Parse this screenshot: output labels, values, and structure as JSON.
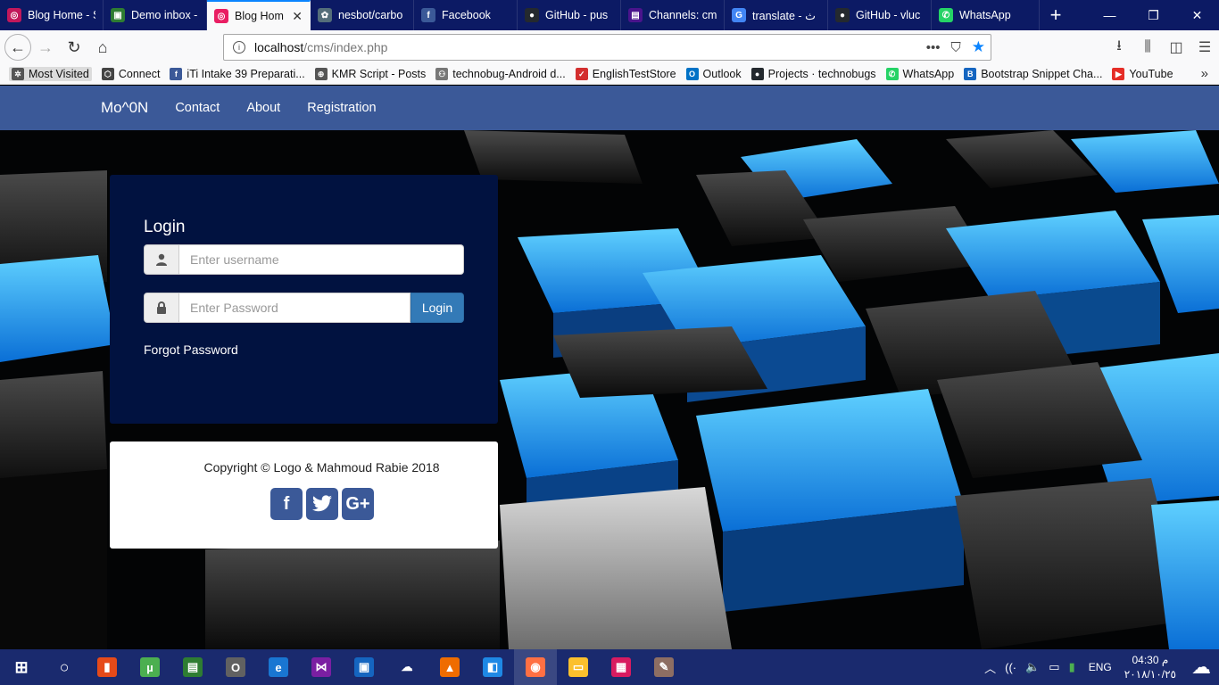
{
  "browser": {
    "tabs": [
      {
        "title": "Blog Home - S",
        "favicon_color": "#c2185b",
        "glyph": "◎"
      },
      {
        "title": "Demo inbox -",
        "favicon_color": "#2e7d32",
        "glyph": "▣"
      },
      {
        "title": "Blog Hom",
        "favicon_color": "#e91e63",
        "glyph": "◎",
        "active": true,
        "close": "✕"
      },
      {
        "title": "nesbot/carbo",
        "favicon_color": "#546e7a",
        "glyph": "✿"
      },
      {
        "title": "Facebook",
        "favicon_color": "#3b5998",
        "glyph": "f"
      },
      {
        "title": "GitHub - pus",
        "favicon_color": "#24292e",
        "glyph": "●"
      },
      {
        "title": "Channels: cm",
        "favicon_color": "#4a148c",
        "glyph": "▤"
      },
      {
        "title": "translate - ث",
        "favicon_color": "#4285f4",
        "glyph": "G"
      },
      {
        "title": "GitHub - vluc",
        "favicon_color": "#24292e",
        "glyph": "●"
      },
      {
        "title": "WhatsApp",
        "favicon_color": "#25d366",
        "glyph": "✆"
      }
    ],
    "new_tab": "+",
    "window_controls": {
      "minimize": "—",
      "restore": "❐",
      "close": "✕"
    },
    "url": {
      "host": "localhost",
      "path": "/cms/index.php"
    },
    "url_actions": {
      "more": "•••",
      "pocket": "⛉",
      "bookmark": "★"
    },
    "toolbar_right": {
      "downloads": "⭳",
      "library": "⫼",
      "sidebar": "◫",
      "menu": "☰"
    },
    "nav": {
      "back": "←",
      "forward": "→",
      "reload": "↻",
      "home": "⌂"
    },
    "bookmarks": [
      {
        "label": "Most Visited",
        "icon_color": "#555",
        "glyph": "✲"
      },
      {
        "label": "Connect",
        "icon_color": "#444",
        "glyph": "⬡"
      },
      {
        "label": "iTi Intake 39 Preparati...",
        "icon_color": "#3b5998",
        "glyph": "f"
      },
      {
        "label": "KMR Script - Posts",
        "icon_color": "#555",
        "glyph": "⊕"
      },
      {
        "label": "technobug-Android d...",
        "icon_color": "#777",
        "glyph": "⚇"
      },
      {
        "label": "EnglishTestStore",
        "icon_color": "#d32f2f",
        "glyph": "✓"
      },
      {
        "label": "Outlook",
        "icon_color": "#0072c6",
        "glyph": "O"
      },
      {
        "label": "Projects · technobugs",
        "icon_color": "#24292e",
        "glyph": "●"
      },
      {
        "label": "WhatsApp",
        "icon_color": "#25d366",
        "glyph": "✆"
      },
      {
        "label": "Bootstrap Snippet Cha...",
        "icon_color": "#1565c0",
        "glyph": "B"
      },
      {
        "label": "YouTube",
        "icon_color": "#e52d27",
        "glyph": "▶"
      }
    ],
    "bookmarks_overflow": "»"
  },
  "site": {
    "brand": "Mo^0N",
    "nav_links": [
      "Contact",
      "About",
      "Registration"
    ],
    "login": {
      "title": "Login",
      "username_placeholder": "Enter username",
      "password_placeholder": "Enter Password",
      "submit_label": "Login",
      "forgot_label": "Forgot Password"
    },
    "footer": {
      "copyright": "Copyright © Logo & Mahmoud Rabie 2018",
      "social": [
        {
          "name": "facebook",
          "glyph": "f"
        },
        {
          "name": "twitter",
          "glyph": "t"
        },
        {
          "name": "google-plus",
          "glyph": "G+"
        }
      ]
    },
    "colors": {
      "navbar": "#3b5998",
      "login_panel": "#011240",
      "primary_button": "#337ab7"
    }
  },
  "taskbar": {
    "apps": [
      {
        "name": "start",
        "glyph": "⊞",
        "color": "transparent"
      },
      {
        "name": "cortana",
        "glyph": "○",
        "color": "transparent"
      },
      {
        "name": "app-red",
        "glyph": "▮",
        "color": "#e64a19"
      },
      {
        "name": "utorrent",
        "glyph": "µ",
        "color": "#4caf50"
      },
      {
        "name": "app-printer",
        "glyph": "▤",
        "color": "#2e7d32"
      },
      {
        "name": "opera",
        "glyph": "O",
        "color": "#616161"
      },
      {
        "name": "edge",
        "glyph": "e",
        "color": "#1976d2"
      },
      {
        "name": "visual-studio",
        "glyph": "⋈",
        "color": "#7b1fa2"
      },
      {
        "name": "app-frame",
        "glyph": "▣",
        "color": "#1565c0"
      },
      {
        "name": "soundcloud",
        "glyph": "☁",
        "color": "transparent"
      },
      {
        "name": "vlc",
        "glyph": "▲",
        "color": "#ef6c00"
      },
      {
        "name": "vscode",
        "glyph": "◧",
        "color": "#1e88e5"
      },
      {
        "name": "firefox",
        "glyph": "◉",
        "color": "#ff7043",
        "active": true
      },
      {
        "name": "file-explorer",
        "glyph": "▭",
        "color": "#fbc02d"
      },
      {
        "name": "app-pink",
        "glyph": "▦",
        "color": "#d81b60"
      },
      {
        "name": "paint",
        "glyph": "✎",
        "color": "#8d6e63"
      }
    ],
    "tray": {
      "chevron": "︿",
      "network": "((·",
      "volume": "🔈",
      "battery": "▭",
      "app": "▮",
      "language": "ENG",
      "notifications": "☁"
    },
    "clock": {
      "time": "04:30 م",
      "date": "٢٠١٨/١٠/٢٥"
    }
  }
}
